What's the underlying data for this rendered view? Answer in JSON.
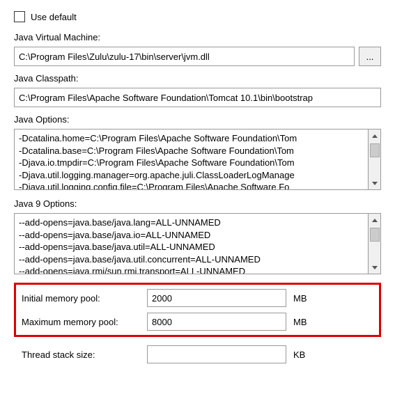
{
  "use_default": {
    "label": "Use default",
    "checked": false
  },
  "jvm": {
    "label": "Java Virtual Machine:",
    "value": "C:\\Program Files\\Zulu\\zulu-17\\bin\\server\\jvm.dll",
    "browse": "..."
  },
  "classpath": {
    "label": "Java Classpath:",
    "value": "C:\\Program Files\\Apache Software Foundation\\Tomcat 10.1\\bin\\bootstrap"
  },
  "java_options": {
    "label": "Java Options:",
    "lines": "-Dcatalina.home=C:\\Program Files\\Apache Software Foundation\\Tom\n-Dcatalina.base=C:\\Program Files\\Apache Software Foundation\\Tom\n-Djava.io.tmpdir=C:\\Program Files\\Apache Software Foundation\\Tom\n-Djava.util.logging.manager=org.apache.juli.ClassLoaderLogManage\n-Djava.util.logging.config.file=C:\\Program Files\\Apache Software Fo"
  },
  "java9_options": {
    "label": "Java 9 Options:",
    "lines": "--add-opens=java.base/java.lang=ALL-UNNAMED\n--add-opens=java.base/java.io=ALL-UNNAMED\n--add-opens=java.base/java.util=ALL-UNNAMED\n--add-opens=java.base/java.util.concurrent=ALL-UNNAMED\n--add-opens=java.rmi/sun.rmi.transport=ALL-UNNAMED"
  },
  "memory": {
    "initial_label": "Initial memory pool:",
    "initial_value": "2000",
    "max_label": "Maximum memory pool:",
    "max_value": "8000",
    "unit": "MB"
  },
  "thread_stack": {
    "label": "Thread stack size:",
    "value": "",
    "unit": "KB"
  }
}
